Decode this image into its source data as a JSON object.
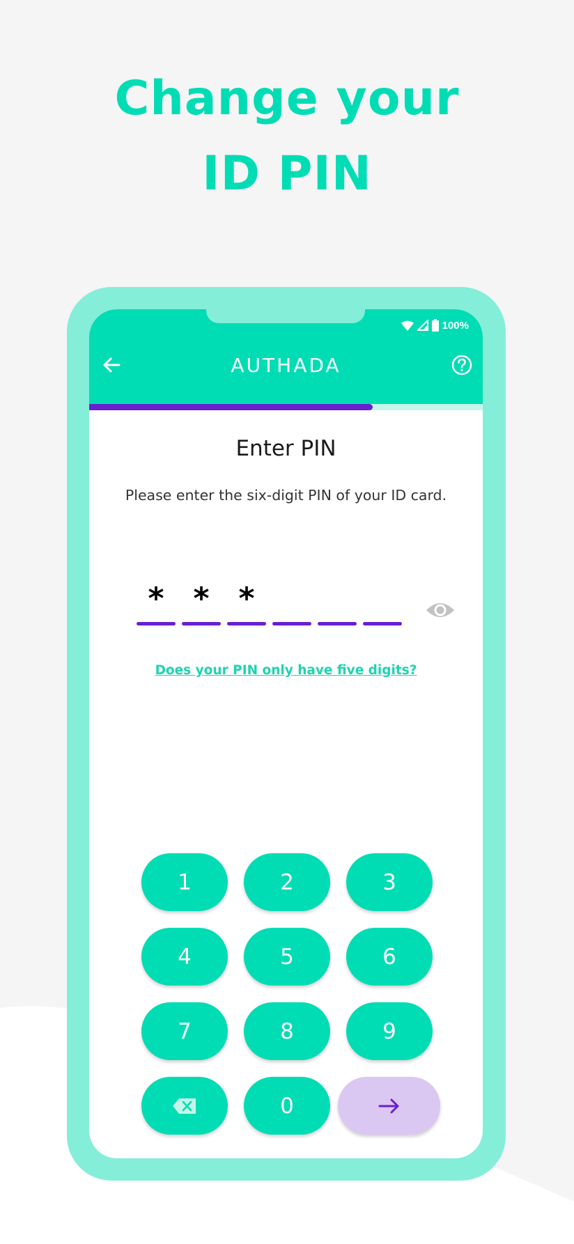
{
  "headline": {
    "line1": "Change your",
    "line2": "ID PIN"
  },
  "colors": {
    "brand_teal": "#00dcb4",
    "frame_teal": "#84eed9",
    "accent_purple": "#6a1fd1",
    "next_button_bg": "#dac8f2",
    "background": "#f5f5f5"
  },
  "status_bar": {
    "icons": [
      "wifi-icon",
      "signal-icon",
      "battery-icon"
    ],
    "battery": "100%"
  },
  "app_bar": {
    "back_icon": "arrow-left-icon",
    "brand": "AUTHADA",
    "help_icon": "help-circle-icon"
  },
  "progress": {
    "value": 0.72
  },
  "content": {
    "title": "Enter PIN",
    "description": "Please enter the six-digit PIN of your ID card.",
    "pin": {
      "length": 6,
      "entered": [
        "*",
        "*",
        "*",
        "",
        "",
        ""
      ]
    },
    "visibility_icon": "eye-icon",
    "five_digit_link": "Does your PIN only have five digits?"
  },
  "keypad": {
    "keys": [
      {
        "label": "1",
        "type": "digit"
      },
      {
        "label": "2",
        "type": "digit"
      },
      {
        "label": "3",
        "type": "digit"
      },
      {
        "label": "4",
        "type": "digit"
      },
      {
        "label": "5",
        "type": "digit"
      },
      {
        "label": "6",
        "type": "digit"
      },
      {
        "label": "7",
        "type": "digit"
      },
      {
        "label": "8",
        "type": "digit"
      },
      {
        "label": "9",
        "type": "digit"
      },
      {
        "label": "",
        "type": "backspace",
        "icon": "backspace-icon"
      },
      {
        "label": "0",
        "type": "digit"
      },
      {
        "label": "",
        "type": "next",
        "icon": "arrow-right-icon"
      }
    ]
  }
}
